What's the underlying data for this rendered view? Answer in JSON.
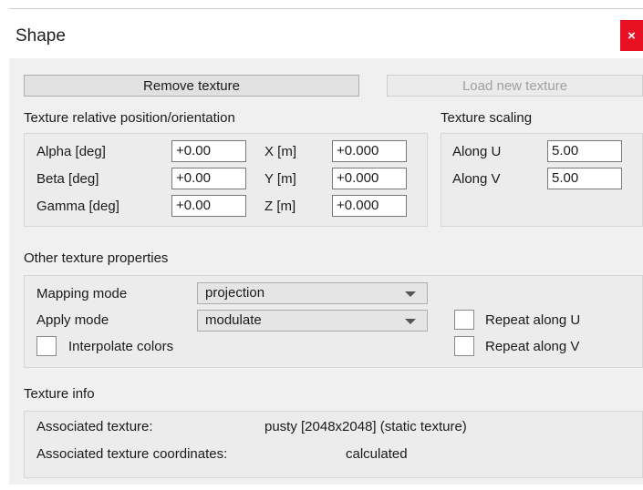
{
  "window": {
    "title": "Shape",
    "close_label": "×"
  },
  "buttons": {
    "remove_texture": "Remove texture",
    "load_new_texture": "Load new texture"
  },
  "position": {
    "heading": "Texture relative position/orientation",
    "alpha_label": "Alpha [deg]",
    "alpha_value": "+0.00",
    "beta_label": "Beta [deg]",
    "beta_value": "+0.00",
    "gamma_label": "Gamma [deg]",
    "gamma_value": "+0.00",
    "x_label": "X [m]",
    "x_value": "+0.000",
    "y_label": "Y [m]",
    "y_value": "+0.000",
    "z_label": "Z [m]",
    "z_value": "+0.000"
  },
  "scaling": {
    "heading": "Texture scaling",
    "u_label": "Along U",
    "u_value": "5.00",
    "v_label": "Along V",
    "v_value": "5.00"
  },
  "other": {
    "heading": "Other texture properties",
    "mapping_label": "Mapping mode",
    "mapping_value": "projection",
    "apply_label": "Apply mode",
    "apply_value": "modulate",
    "interpolate_label": "Interpolate colors",
    "interpolate_checked": false,
    "repeat_u_label": "Repeat along U",
    "repeat_u_checked": false,
    "repeat_v_label": "Repeat along V",
    "repeat_v_checked": false
  },
  "info": {
    "heading": "Texture info",
    "assoc_label": "Associated texture:",
    "assoc_value": "pusty [2048x2048]  (static texture)",
    "coords_label": "Associated texture coordinates:",
    "coords_value": "calculated"
  }
}
